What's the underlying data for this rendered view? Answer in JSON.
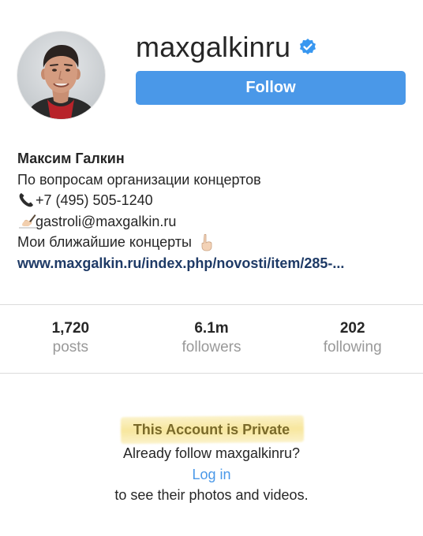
{
  "profile": {
    "username": "maxgalkinru",
    "verified": true,
    "follow_label": "Follow",
    "accent_color": "#4a98e8"
  },
  "bio": {
    "name": "Максим Галкин",
    "line1": "По вопросам организации концертов",
    "phone_icon": "telephone-icon",
    "phone": "+7 (495) 505-1240",
    "email_icon": "writing-hand-icon",
    "email": "gastroli@maxgalkin.ru",
    "concerts": "Мои ближайшие концерты",
    "concerts_icon": "pointing-down-icon",
    "link": "www.maxgalkin.ru/index.php/novosti/item/285-..."
  },
  "stats": [
    {
      "value": "1,720",
      "label": "posts"
    },
    {
      "value": "6.1m",
      "label": "followers"
    },
    {
      "value": "202",
      "label": "following"
    }
  ],
  "private_notice": {
    "title": "This Account is Private",
    "line1": "Already follow maxgalkinru?",
    "login_label": "Log in",
    "line2": "to see their photos and videos."
  }
}
